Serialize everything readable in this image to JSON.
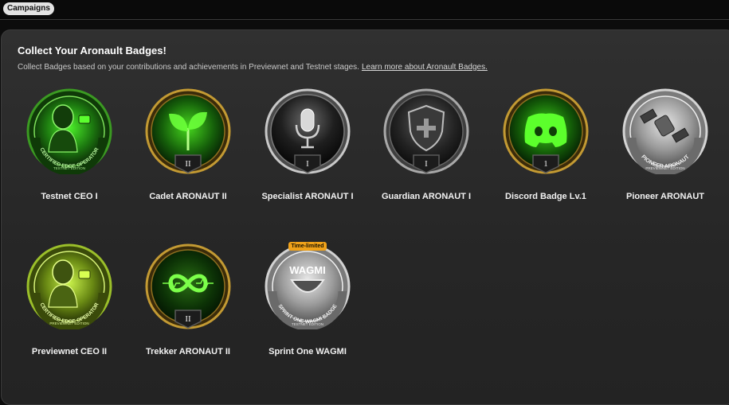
{
  "topbar": {
    "campaigns_label": "Campaigns"
  },
  "header": {
    "title": "Collect Your Aronault Badges!",
    "description": "Collect Badges based on your contributions and achievements in Previewnet and Testnet stages.",
    "learn_more": "Learn more about Aronault Badges."
  },
  "badges": [
    {
      "name": "Testnet CEO I",
      "icon": "robot-operator-icon",
      "ring_text": "CERTIFIED EDGE OPERATOR",
      "edition": "TESTNET EDITION"
    },
    {
      "name": "Cadet ARONAUT II",
      "icon": "sprout-icon",
      "level": "II"
    },
    {
      "name": "Specialist ARONAUT I",
      "icon": "microphone-icon",
      "level": "I"
    },
    {
      "name": "Guardian ARONAUT I",
      "icon": "shield-plus-icon",
      "level": "I"
    },
    {
      "name": "Discord Badge Lv.1",
      "icon": "discord-icon",
      "level": "1"
    },
    {
      "name": "Pioneer ARONAUT",
      "icon": "satellite-icon",
      "ring_text": "PIONEER ARONAUT",
      "edition": "PREVIEWNET EDITION"
    },
    {
      "name": "Previewnet CEO II",
      "icon": "robot-operator-icon",
      "ring_text": "CERTIFIED EDGE OPERATOR",
      "edition": "PREVIEWNET EDITION"
    },
    {
      "name": "Trekker ARONAUT II",
      "icon": "infinity-icon",
      "level": "II"
    },
    {
      "name": "Sprint One WAGMI",
      "icon": "wagmi-face-icon",
      "tag": "Time-limited",
      "emblem": "WAGMI",
      "ring_text": "SPRINT ONE WAGMI BADGE",
      "edition": "TESTNET EDITION"
    }
  ],
  "colors": {
    "green": "#39d017",
    "gold": "#b48a2a",
    "silver": "#bdbdbd",
    "tag": "#f0a21a"
  }
}
